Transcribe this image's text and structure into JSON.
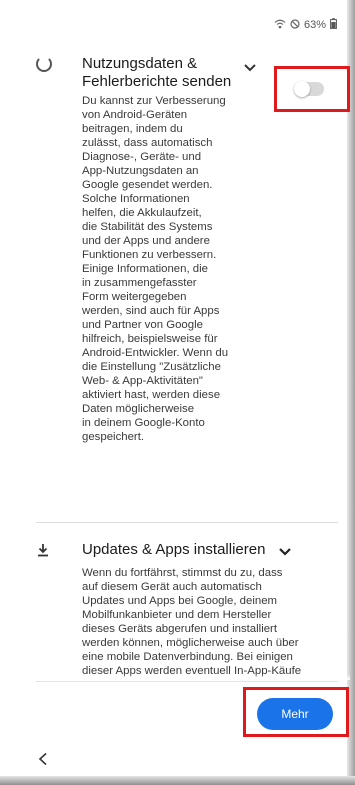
{
  "status_bar": {
    "battery": "63%"
  },
  "usage_section": {
    "title": "Nutzungsdaten & Fehlerberichte senden",
    "toggle_state": "off",
    "body": "Du kannst zur Verbesserung\nvon Android-Geräten\nbeitragen, indem du\nzulässt, dass automatisch\nDiagnose-, Geräte- und\nApp-Nutzungsdaten an\nGoogle gesendet werden.\nSolche Informationen\nhelfen, die Akkulaufzeit,\ndie Stabilität des Systems\nund der Apps und andere\nFunktionen zu verbessern.\nEinige Informationen, die\nin zusammengefasster\nForm weitergegeben\nwerden, sind auch für Apps\nund Partner von Google\nhilfreich, beispielsweise für\nAndroid-Entwickler. Wenn du\ndie Einstellung \"Zusätzliche\nWeb- & App-Aktivitäten\"\naktiviert hast, werden diese\nDaten möglicherweise\nin deinem Google-Konto\ngespeichert."
  },
  "updates_section": {
    "title": "Updates & Apps installieren",
    "body": "Wenn du fortfährst, stimmst du zu, dass\nauf diesem Gerät auch automatisch\nUpdates und Apps bei Google, deinem\nMobilfunkanbieter und dem Hersteller\ndieses Geräts abgerufen und installiert\nwerden können, möglicherweise auch über\neine mobile Datenverbindung. Bei einigen\ndieser Apps werden eventuell In-App-Käufe"
  },
  "footer": {
    "more_label": "Mehr"
  },
  "colors": {
    "accent": "#1a73e8",
    "highlight": "#e0191c"
  }
}
